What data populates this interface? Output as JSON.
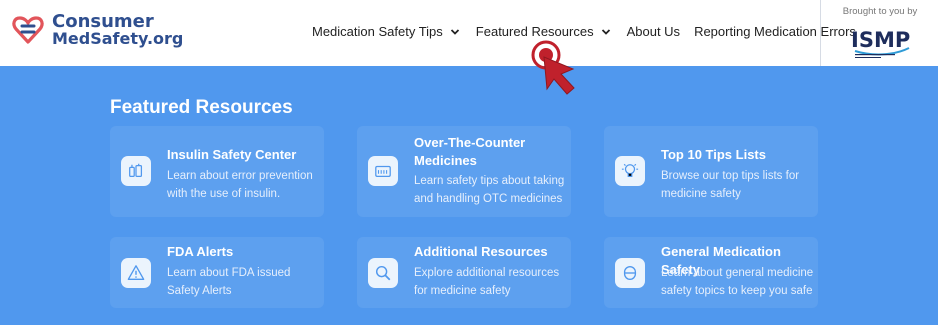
{
  "logo": {
    "line1": "Consumer",
    "line2": "MedSafety.org"
  },
  "nav": {
    "items": [
      {
        "label": "Medication Safety Tips",
        "dropdown": true
      },
      {
        "label": "Featured Resources",
        "dropdown": true
      },
      {
        "label": "About Us",
        "dropdown": false
      },
      {
        "label": "Reporting Medication Errors",
        "dropdown": false
      }
    ]
  },
  "partner": {
    "brought": "Brought to you by",
    "logo_text": "ISMP"
  },
  "featured": {
    "title": "Featured Resources",
    "cards": [
      {
        "title": "Insulin Safety Center",
        "desc": "Learn about error prevention with the use of insulin.",
        "icon": "insulin-icon"
      },
      {
        "title": "Over-The-Counter Medicines",
        "desc": "Learn safety tips about taking and handling OTC medicines",
        "icon": "otc-box-icon"
      },
      {
        "title": "Top 10 Tips Lists",
        "desc": "Browse our top tips lists for medicine safety",
        "icon": "lightbulb-icon"
      },
      {
        "title": "FDA Alerts",
        "desc": "Learn about FDA issued Safety Alerts",
        "icon": "warning-icon"
      },
      {
        "title": "Additional Resources",
        "desc": "Explore additional resources for medicine safety",
        "icon": "search-icon"
      },
      {
        "title": "General Medication Safety",
        "desc": "Learn about general medicine safety topics to keep you safe",
        "icon": "pill-icon"
      }
    ]
  },
  "colors": {
    "brand": "#2f4f8f",
    "accent": "#e2555b",
    "section_bg": "#5098ee",
    "pointer": "#c0212c"
  }
}
